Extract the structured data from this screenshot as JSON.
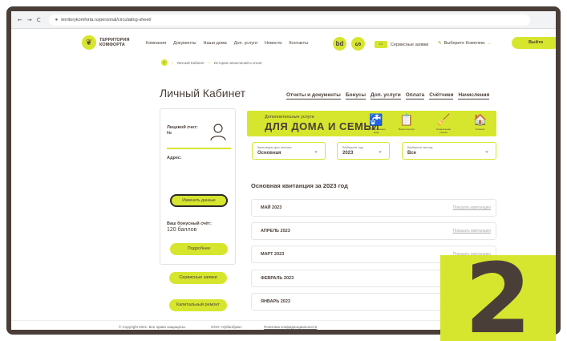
{
  "browser": {
    "url": "territorykomforta.ru/personal/circulating-sheet/",
    "back": "←",
    "forward": "→",
    "reload": "C"
  },
  "header": {
    "logo_line1": "ТЕРРИТОРИЯ",
    "logo_line2": "КОМФОРТА",
    "nav": [
      "Компания",
      "Документы",
      "Наши дома",
      "Доп. услуги",
      "Новости",
      "Контакты"
    ],
    "icon1": "bd",
    "icon2": "ᔕ",
    "service_requests": "Сервисные заявки",
    "select_complex": "Выберите Комплекс",
    "exit": "Выйти"
  },
  "breadcrumb": {
    "home": "⌂",
    "items": [
      "Личный Кабинет",
      "История начислений и оплат"
    ]
  },
  "page": {
    "title": "Личный Кабинет",
    "tabs": [
      "Отчеты и документы",
      "Бонусы",
      "Доп. услуги",
      "Оплата",
      "Счётчики",
      "Начисления"
    ]
  },
  "sidebar": {
    "account_label": "Лицевой счет:",
    "account_number": "№",
    "address_label": "Адрес:",
    "edit_button": "Изменить данные",
    "bonus_label": "Ваш бонусный счёт:",
    "bonus_value": "120 баллов",
    "more_button": "Подробнее",
    "service_button": "Сервисные заявки",
    "repair_button": "Капитальный ремонт"
  },
  "banner": {
    "small": "Дополнительные услуги",
    "big": "ДЛЯ ДОМА И СЕМЬИ",
    "items": [
      {
        "icon": "🚰",
        "label": "Бутилированная вода"
      },
      {
        "icon": "📋",
        "label": "Вывоз мусора"
      },
      {
        "icon": "🧹",
        "label": "Генеральная уборка"
      },
      {
        "icon": "🏠",
        "label": "Клининг"
      }
    ]
  },
  "filters": {
    "receipt": {
      "label": "Квитанция для оплаты:",
      "value": "Основная"
    },
    "year": {
      "label": "Выберите год:",
      "value": "2023"
    },
    "month": {
      "label": "Выберите месяц:",
      "value": "Все"
    }
  },
  "receipts": {
    "title": "Основная квитанция за 2023 год",
    "link": "Показать квитанцию",
    "months": [
      "МАЙ 2023",
      "АПРЕЛЬ 2023",
      "МАРТ 2023",
      "ФЕВРАЛЬ 2023",
      "ЯНВАРЬ 2023"
    ]
  },
  "footer": {
    "copyright": "© Copyright 2021. Все права защищены.",
    "company": "ООО «Урбанбрик»",
    "policy": "Политика конфиденциальности",
    "phone": "+7(812) 209-9..."
  },
  "overlay": {
    "number": "2"
  },
  "colors": {
    "accent": "#d6e62e",
    "brand_dark": "#4a3f38"
  }
}
